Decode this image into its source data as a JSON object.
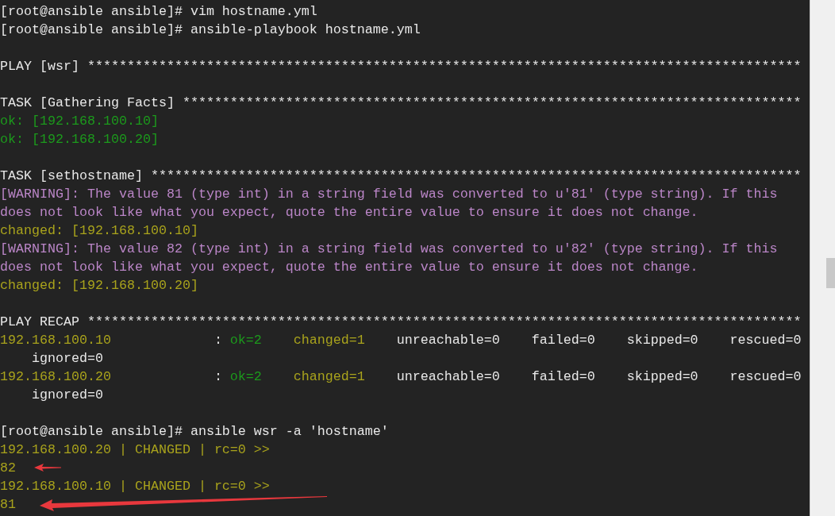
{
  "terminal": {
    "blocks": [
      [
        [
          {
            "text": "[root@ansible ansible]# vim hostname.yml",
            "kind": "text"
          }
        ],
        [
          {
            "text": "[root@ansible ansible]# ansible-playbook hostname.yml",
            "kind": "text"
          }
        ]
      ],
      [
        [
          {
            "text": "PLAY [wsr] ******************************************************************************************",
            "kind": "text"
          }
        ]
      ],
      [
        [
          {
            "text": "TASK [Gathering Facts] ******************************************************************************",
            "kind": "text"
          }
        ],
        [
          {
            "text": "ok: [192.168.100.10]",
            "kind": "ok"
          }
        ],
        [
          {
            "text": "ok: [192.168.100.20]",
            "kind": "ok"
          }
        ]
      ],
      [
        [
          {
            "text": "TASK [sethostname] **********************************************************************************",
            "kind": "text"
          }
        ],
        [
          {
            "text": "[WARNING]: The value 81 (type int) in a string field was converted to u'81' (type string). If this",
            "kind": "warning"
          }
        ],
        [
          {
            "text": "does not look like what you expect, quote the entire value to ensure it does not change.",
            "kind": "warning"
          }
        ],
        [
          {
            "text": "changed: [192.168.100.10]",
            "kind": "changed"
          }
        ],
        [
          {
            "text": "[WARNING]: The value 82 (type int) in a string field was converted to u'82' (type string). If this",
            "kind": "warning"
          }
        ],
        [
          {
            "text": "does not look like what you expect, quote the entire value to ensure it does not change.",
            "kind": "warning"
          }
        ],
        [
          {
            "text": "changed: [192.168.100.20]",
            "kind": "changed"
          }
        ]
      ],
      [
        [
          {
            "text": "PLAY RECAP ******************************************************************************************",
            "kind": "text"
          }
        ],
        [
          {
            "text": "192.168.100.10",
            "kind": "host"
          },
          {
            "text": "             :",
            "kind": "text"
          },
          {
            "text": " ok=2",
            "kind": "ok"
          },
          {
            "text": "    changed=1",
            "kind": "changed"
          },
          {
            "text": "    unreachable=0    failed=0    skipped=0    rescued=0",
            "kind": "text"
          }
        ],
        [
          {
            "text": "    ignored=0",
            "kind": "text"
          }
        ],
        [
          {
            "text": "192.168.100.20",
            "kind": "host"
          },
          {
            "text": "             :",
            "kind": "text"
          },
          {
            "text": " ok=2",
            "kind": "ok"
          },
          {
            "text": "    changed=1",
            "kind": "changed"
          },
          {
            "text": "    unreachable=0    failed=0    skipped=0    rescued=0",
            "kind": "text"
          }
        ],
        [
          {
            "text": "    ignored=0",
            "kind": "text"
          }
        ]
      ],
      [
        [
          {
            "text": "[root@ansible ansible]# ansible wsr -a 'hostname'",
            "kind": "text"
          }
        ],
        [
          {
            "text": "192.168.100.20 | CHANGED | rc=0 >>",
            "kind": "changed"
          }
        ],
        [
          {
            "text": "82",
            "kind": "changed"
          }
        ],
        [
          {
            "text": "192.168.100.10 | CHANGED | rc=0 >>",
            "kind": "changed"
          }
        ],
        [
          {
            "text": "81",
            "kind": "changed"
          }
        ]
      ]
    ]
  }
}
